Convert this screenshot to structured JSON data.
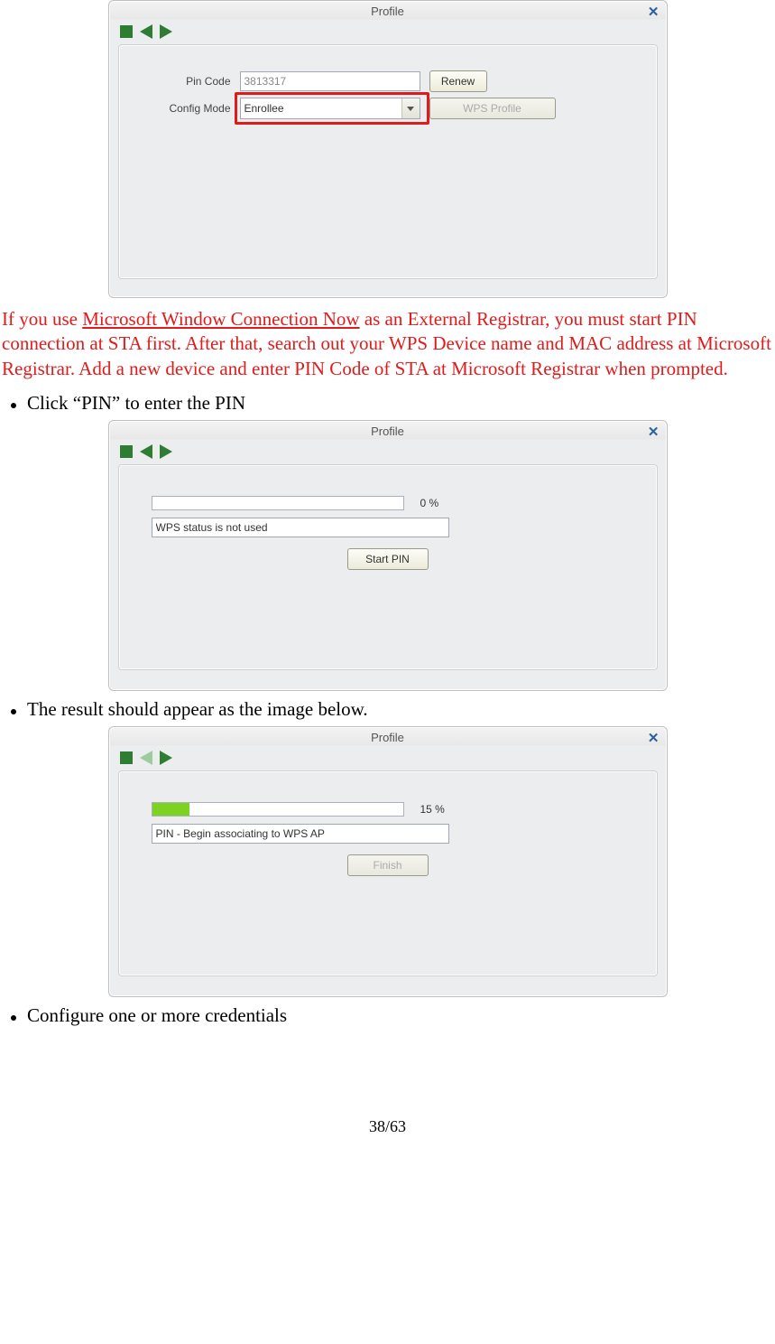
{
  "page_number": "38/63",
  "panel1": {
    "title": "Profile",
    "pin_label": "Pin Code",
    "pin_value": "3813317",
    "renew_label": "Renew",
    "config_label": "Config Mode",
    "config_value": "Enrollee",
    "wps_profile_label": "WPS Profile"
  },
  "note": {
    "prefix": "If you use ",
    "link_text": "Microsoft Window Connection Now",
    "suffix": " as an External Registrar, you must start PIN connection at STA first. After that, search out your WPS Device name and MAC address at Microsoft Registrar. Add a new device and enter PIN Code of STA at Microsoft Registrar when prompted."
  },
  "bullet1": "Click “PIN” to enter the PIN",
  "panel2": {
    "title": "Profile",
    "progress_pct": "0 %",
    "progress_fill": 0,
    "status": "WPS status is not used",
    "start_pin_label": "Start PIN"
  },
  "bullet2": "The result should appear as the image below.",
  "panel3": {
    "title": "Profile",
    "progress_pct": "15 %",
    "progress_fill": 15,
    "status": "PIN - Begin associating to WPS AP",
    "finish_label": "Finish"
  },
  "bullet3": "Configure one or more credentials"
}
